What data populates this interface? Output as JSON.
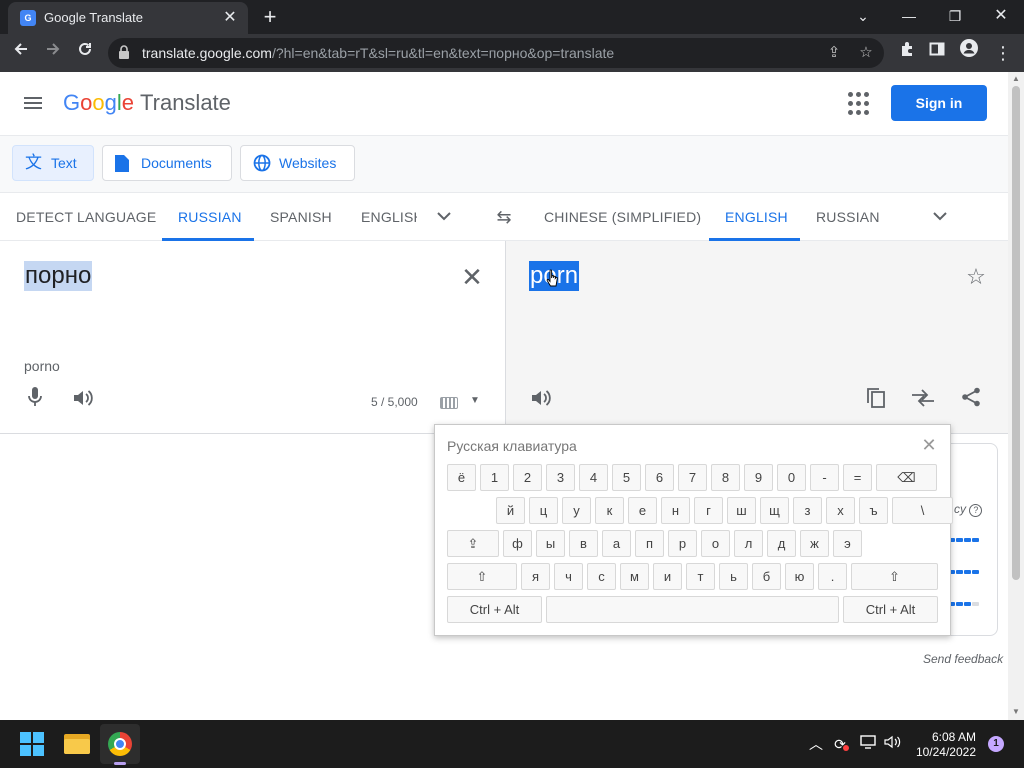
{
  "browser": {
    "tab_title": "Google Translate",
    "url_host": "translate.google.com",
    "url_path": "/?hl=en&tab=rT&sl=ru&tl=en&text=порно&op=translate"
  },
  "header": {
    "logo_letters": [
      "G",
      "o",
      "o",
      "g",
      "l",
      "e"
    ],
    "product": "Translate",
    "sign_in": "Sign in"
  },
  "modes": [
    {
      "label": "Text",
      "icon": "translate-icon",
      "active": true
    },
    {
      "label": "Documents",
      "icon": "document-icon",
      "active": false
    },
    {
      "label": "Websites",
      "icon": "globe-icon",
      "active": false
    }
  ],
  "source_langs": [
    "DETECT LANGUAGE",
    "RUSSIAN",
    "SPANISH",
    "ENGLISH"
  ],
  "target_langs": [
    "CHINESE (SIMPLIFIED)",
    "ENGLISH",
    "RUSSIAN"
  ],
  "source": {
    "text": "порно",
    "transliteration": "porno",
    "char_count": "5 / 5,000"
  },
  "target": {
    "text": "porn"
  },
  "feedback": {
    "help_text": "cy",
    "send_feedback": "Send feedback",
    "bar_levels": [
      5,
      5,
      4
    ]
  },
  "keyboard": {
    "title": "Русская клавиатура",
    "row1": [
      "ё",
      "1",
      "2",
      "3",
      "4",
      "5",
      "6",
      "7",
      "8",
      "9",
      "0",
      "-",
      "=",
      "⌫"
    ],
    "row2": [
      "й",
      "ц",
      "у",
      "к",
      "е",
      "н",
      "г",
      "ш",
      "щ",
      "з",
      "х",
      "ъ",
      "\\"
    ],
    "row3": [
      "⇪",
      "ф",
      "ы",
      "в",
      "а",
      "п",
      "р",
      "о",
      "л",
      "д",
      "ж",
      "э"
    ],
    "row4": [
      "⇧",
      "я",
      "ч",
      "с",
      "м",
      "и",
      "т",
      "ь",
      "б",
      "ю",
      ".",
      "⇧"
    ],
    "row5": [
      "Ctrl + Alt",
      "",
      "Ctrl + Alt"
    ]
  },
  "taskbar": {
    "time": "6:08 AM",
    "date": "10/24/2022",
    "notification_count": "1"
  },
  "colors": {
    "accent": "#1a73e8",
    "selection_source": "#c5d7f2",
    "selection_target": "#1a73e8"
  }
}
